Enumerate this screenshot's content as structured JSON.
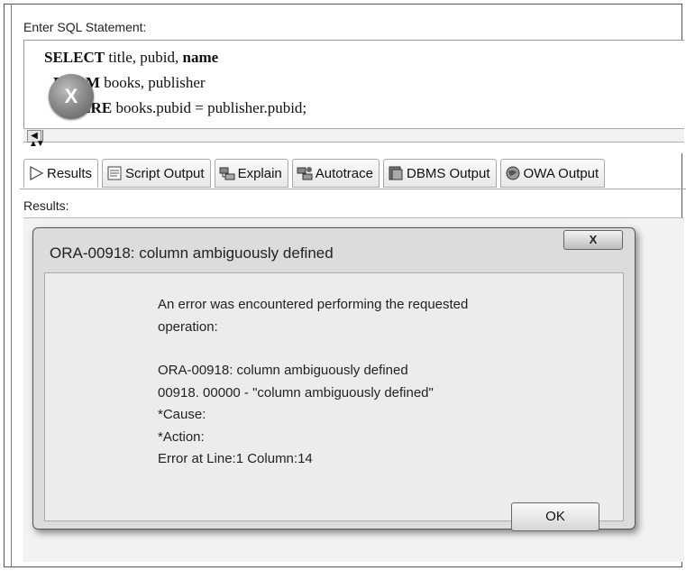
{
  "sql_panel": {
    "label": "Enter SQL Statement:",
    "line1": {
      "kw": "SELECT",
      "rest": " title, pubid, ",
      "kw2": "name"
    },
    "line2": {
      "kw": "FROM",
      "rest": " books, publisher"
    },
    "line3": {
      "kw": "WHERE",
      "rest": " books.pubid = publisher.pubid;"
    }
  },
  "tabs": [
    {
      "label": "Results",
      "icon": "play-triangle-icon"
    },
    {
      "label": "Script Output",
      "icon": "document-icon"
    },
    {
      "label": "Explain",
      "icon": "explain-plan-icon"
    },
    {
      "label": "Autotrace",
      "icon": "autotrace-icon"
    },
    {
      "label": "DBMS Output",
      "icon": "dbms-output-icon"
    },
    {
      "label": "OWA Output",
      "icon": "globe-icon"
    }
  ],
  "results_label": "Results:",
  "dialog": {
    "title": "ORA-00918: column ambiguously defined",
    "close": "X",
    "icon_glyph": "X",
    "message_line1": "An error was encountered performing the requested",
    "message_line2": "operation:",
    "details": [
      "ORA-00918: column ambiguously defined",
      "00918. 00000 -  \"column ambiguously defined\"",
      "*Cause:",
      "*Action:",
      "Error at Line:1 Column:14"
    ],
    "ok_label": "OK"
  },
  "colors": {
    "accent": "#777777",
    "dialog_bg": "#dcdcdc"
  }
}
